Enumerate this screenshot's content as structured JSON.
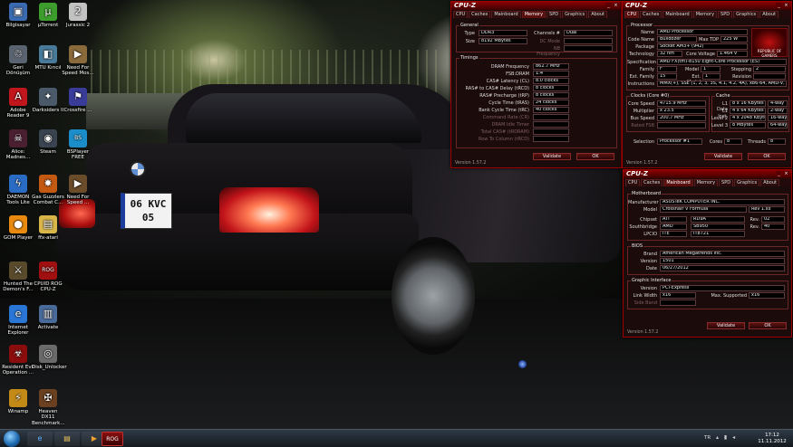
{
  "wallpaper": {
    "plate_line1": "06 KVC",
    "plate_line2": "05"
  },
  "desktop_icons": [
    {
      "label": "Bilgisayar",
      "icon": "computer-icon",
      "color": "#3a6ab0",
      "glyph": "▣"
    },
    {
      "label": "Geri Dönüşüm",
      "icon": "recycle-bin-icon",
      "color": "#5a6470",
      "glyph": "♲"
    },
    {
      "label": "Adobe Reader 9",
      "icon": "adobe-reader-icon",
      "color": "#c2161d",
      "glyph": "A"
    },
    {
      "label": "Alice: Madnes...",
      "icon": "alice-madness-icon",
      "color": "#4a2030",
      "glyph": "☠"
    },
    {
      "label": "DAEMON Tools Lite",
      "icon": "daemon-tools-icon",
      "color": "#2a6cc4",
      "glyph": "ϟ"
    },
    {
      "label": "GOM Player",
      "icon": "gom-player-icon",
      "color": "#e88a10",
      "glyph": "●"
    },
    {
      "label": "Hunted The Demon's F...",
      "icon": "hunted-icon",
      "color": "#5a4a2c",
      "glyph": "⚔"
    },
    {
      "label": "Internet Explorer",
      "icon": "internet-explorer-icon",
      "color": "#2a76d6",
      "glyph": "e"
    },
    {
      "label": "Resident Evil Operation ...",
      "icon": "resident-evil-icon",
      "color": "#8a0c0c",
      "glyph": "☣"
    },
    {
      "label": "Winamp",
      "icon": "winamp-icon",
      "color": "#c48a18",
      "glyph": "⚡"
    },
    {
      "label": "µTorrent",
      "icon": "utorrent-icon",
      "color": "#3c9c2c",
      "glyph": "µ"
    },
    {
      "label": "MTU Kırıcıl",
      "icon": "mtu-icon",
      "color": "#4a7a9a",
      "glyph": "◧"
    },
    {
      "label": "Darksiders II",
      "icon": "darksiders-icon",
      "color": "#4a5a6a",
      "glyph": "✦"
    },
    {
      "label": "Steam",
      "icon": "steam-icon",
      "color": "#3a4350",
      "glyph": "◉"
    },
    {
      "label": "Gas Guzzlers Combat C...",
      "icon": "gas-guzzlers-icon",
      "color": "#c45a12",
      "glyph": "✸"
    },
    {
      "label": "ffx-atari",
      "icon": "folder-icon",
      "color": "#d9b64a",
      "glyph": "▤"
    },
    {
      "label": "CPUID ROG CPU-Z",
      "icon": "cpuz-rog-icon",
      "color": "#a01010",
      "glyph": "ROG"
    },
    {
      "label": "Activate",
      "icon": "activate-icon",
      "color": "#4a6a9a",
      "glyph": "▥"
    },
    {
      "label": "Disk_Unlocker",
      "icon": "disk-unlocker-icon",
      "color": "#6a6a6a",
      "glyph": "◎"
    },
    {
      "label": "Heaven DX11 Benchmark...",
      "icon": "heaven-benchmark-icon",
      "color": "#6a4020",
      "glyph": "✠"
    },
    {
      "label": "Jurassic 2",
      "icon": "jurassic-icon",
      "color": "#c2c2c2",
      "glyph": "2"
    },
    {
      "label": "Need For Speed Mos...",
      "icon": "nfs-most-wanted-icon",
      "color": "#8a6a3a",
      "glyph": "▶"
    },
    {
      "label": "Crossfire ...",
      "icon": "crossfire-icon",
      "color": "#3a3c9a",
      "glyph": "⚑"
    },
    {
      "label": "BSPlayer FREE",
      "icon": "bsplayer-icon",
      "color": "#1b8ec9",
      "glyph": "BS"
    },
    {
      "label": "Need For Speed ...",
      "icon": "nfs-icon",
      "color": "#6a4c2a",
      "glyph": "▶"
    }
  ],
  "mem": {
    "title": "CPU-Z",
    "tabs": [
      "CPU",
      "Caches",
      "Mainboard",
      "Memory",
      "SPD",
      "Graphics",
      "About"
    ],
    "general_label": "General",
    "type_label": "Type",
    "type": "DDR3",
    "channels_label": "Channels #",
    "channels": "Dual",
    "size_label": "Size",
    "size": "8192 MBytes",
    "dc_label": "DC Mode",
    "nb_label": "NB Frequency",
    "timings_label": "Timings",
    "rows": [
      [
        "DRAM Frequency",
        "862.7 MHz"
      ],
      [
        "FSB:DRAM",
        "1:4"
      ],
      [
        "CAS# Latency (CL)",
        "8.0 clocks"
      ],
      [
        "RAS# to CAS# Delay (tRCD)",
        "8 clocks"
      ],
      [
        "RAS# Precharge (tRP)",
        "8 clocks"
      ],
      [
        "Cycle Time (tRAS)",
        "24 clocks"
      ],
      [
        "Bank Cycle Time (tRC)",
        "40 clocks"
      ]
    ],
    "dim_rows": [
      "Command Rate (CR)",
      "DRAM Idle Timer",
      "Total CAS# (tRDRAM)",
      "Row To Column (tRCD)"
    ],
    "version": "Version 1.57.2",
    "validate": "Validate",
    "ok": "OK"
  },
  "cpu": {
    "title": "CPU-Z",
    "tabs": [
      "CPU",
      "Caches",
      "Mainboard",
      "Memory",
      "SPD",
      "Graphics",
      "About"
    ],
    "processor_label": "Processor",
    "name_label": "Name",
    "name": "AMD Processor",
    "code_label": "Code Name",
    "code": "Bulldozer",
    "maxtdp_label": "Max TDP",
    "maxtdp": "225 W",
    "package_label": "Package",
    "package": "Socket AM3+ (942)",
    "tech_label": "Technology",
    "tech": "32 nm",
    "voltage_label": "Core Voltage",
    "voltage": "1.464 V",
    "spec_label": "Specification",
    "spec": "AMD FX(tm)-8150 Eight-Core Processor (ES)",
    "family_label": "Family",
    "family": "F",
    "model_label": "Model",
    "model": "1",
    "stepping_label": "Stepping",
    "stepping": "2",
    "extfam_label": "Ext. Family",
    "extfam": "15",
    "extmod_label": "Ext. Model",
    "extmod": "1",
    "rev_label": "Revision",
    "rev": "",
    "inst_label": "Instructions",
    "inst": "MMX(+), SSE (1, 2, 3, 3S, 4.1, 4.2, 4A), x86-64, AMD-V, AES, A",
    "clocks_label": "Clocks (Core #0)",
    "caches_label": "Cache",
    "cspeed_label": "Core Speed",
    "cspeed": "4715.9 MHz",
    "mult_label": "Multiplier",
    "mult": "x 23.5",
    "bus_label": "Bus Speed",
    "bus": "200.7 MHz",
    "fsb_label": "Rated FSB",
    "l1d_label": "L1 Data",
    "l1d": "8 x 16 KBytes",
    "l1d_way": "4-way",
    "l1i_label": "L1 Inst.",
    "l1i": "4 x 64 KBytes",
    "l1i_way": "2-way",
    "l2_label": "Level 2",
    "l2": "4 x 2048 KBytes",
    "l2_way": "16-way",
    "l3_label": "Level 3",
    "l3": "8 MBytes",
    "l3_way": "64-way",
    "sel_label": "Selection",
    "sel": "Processor #1",
    "cores_label": "Cores",
    "cores": "8",
    "threads_label": "Threads",
    "threads": "8",
    "brand": "REPUBLIC OF GAMERS",
    "version": "Version 1.57.2",
    "validate": "Validate",
    "ok": "OK"
  },
  "mb": {
    "title": "CPU-Z",
    "tabs": [
      "CPU",
      "Caches",
      "Mainboard",
      "Memory",
      "SPD",
      "Graphics",
      "About"
    ],
    "mb_label": "Motherboard",
    "manu_label": "Manufacturer",
    "manu": "ASUSTeK COMPUTER INC.",
    "model_label": "Model",
    "model": "Crosshair V Formula",
    "rev": "Rev 1.xx",
    "chipset_label": "Chipset",
    "chipset": "ATI",
    "chipset2": "RD9A",
    "rev_label": "Rev.",
    "chipset_rev": "02",
    "south_label": "Southbridge",
    "south": "AMD",
    "south2": "SB950",
    "south_rev": "40",
    "lpc_label": "LPCIO",
    "lpc": "ITE",
    "lpc2": "IT8721",
    "bios_label": "BIOS",
    "brand_label": "Brand",
    "brand": "American Megatrends Inc.",
    "ver_label": "Version",
    "ver": "1501",
    "date_label": "Date",
    "date": "06/27/2012",
    "gi_label": "Graphic Interface",
    "gver_label": "Version",
    "gver": "PCI-Express",
    "lw_label": "Link Width",
    "lw": "x16",
    "ms_label": "Max. Supported",
    "ms": "x16",
    "sb_label": "Side Band",
    "version": "Version 1.57.2",
    "validate": "Validate",
    "ok": "OK"
  },
  "taskbar": {
    "lang": "TR",
    "time": "17:12",
    "date": "11.11.2012"
  }
}
